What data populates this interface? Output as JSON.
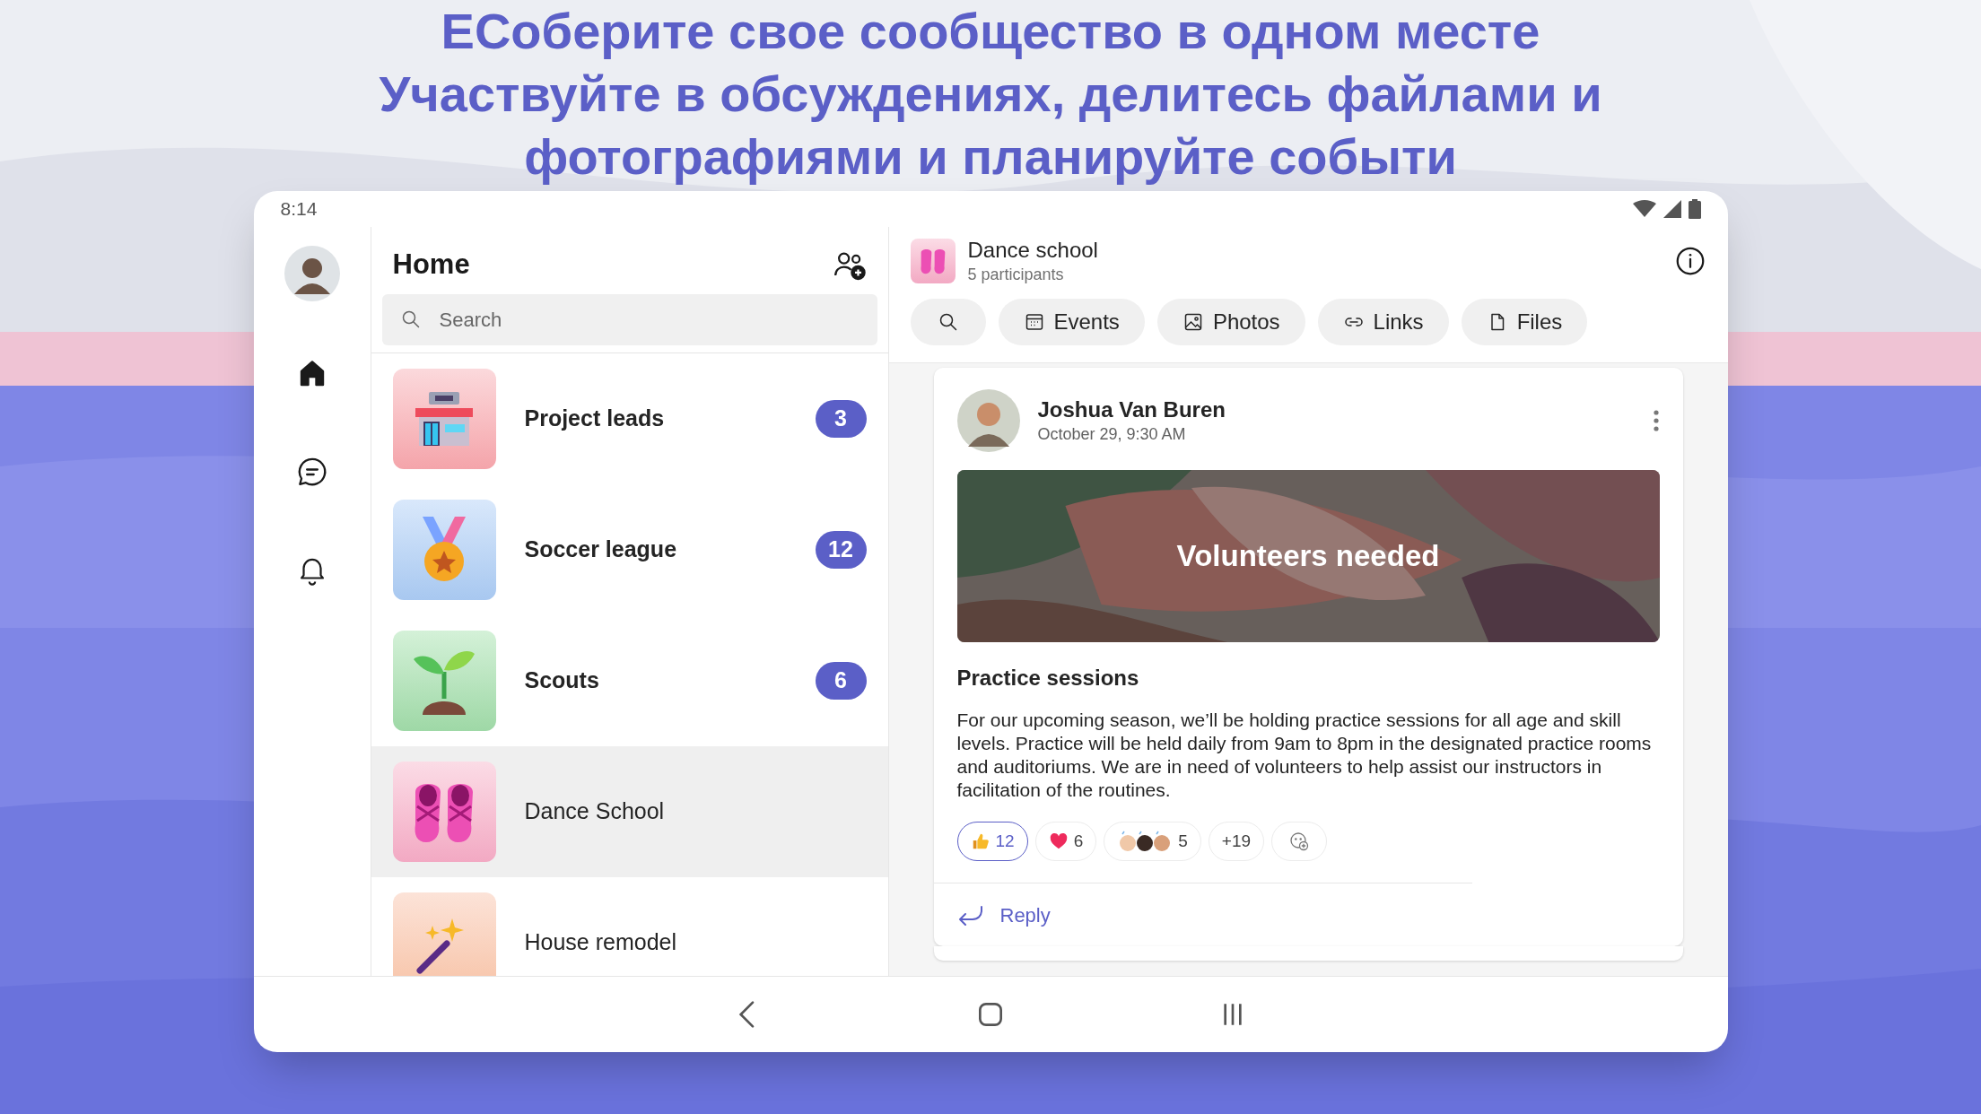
{
  "headline": [
    "ЕСоберите свое сообщество в одном месте",
    "Участвуйте в обсуждениях, делитесь файлами и",
    "фотографиями и планируйте событи"
  ],
  "status_bar": {
    "time": "8:14"
  },
  "nav_rail": [
    {
      "kind": "avatar",
      "selected": false
    },
    {
      "kind": "home",
      "selected": true
    },
    {
      "kind": "chat",
      "selected": false
    },
    {
      "kind": "bell",
      "selected": false
    }
  ],
  "home": {
    "title": "Home",
    "search": {
      "placeholder": "Search"
    },
    "communities": [
      {
        "name": "Project leads",
        "badge": "3",
        "selected": false,
        "kind": "store"
      },
      {
        "name": "Soccer league",
        "badge": "12",
        "selected": false,
        "kind": "medal"
      },
      {
        "name": "Scouts",
        "badge": "6",
        "selected": false,
        "kind": "sprout"
      },
      {
        "name": "Dance School",
        "selected": true,
        "kind": "shoes"
      },
      {
        "name": "House remodel",
        "selected": false,
        "kind": "wand"
      }
    ]
  },
  "conversation": {
    "title": "Dance school",
    "subtitle": "5 participants",
    "chips": [
      {
        "kind": "search"
      },
      {
        "kind": "events",
        "label": "Events"
      },
      {
        "kind": "photos",
        "label": "Photos"
      },
      {
        "kind": "links",
        "label": "Links"
      },
      {
        "kind": "files",
        "label": "Files"
      }
    ],
    "post": {
      "author": "Joshua Van Buren",
      "time": "October 29, 9:30 AM",
      "banner": "Volunteers needed",
      "title": "Practice sessions",
      "body": "For our upcoming season, we’ll be holding practice sessions for all age and skill levels. Practice will be held daily from 9am to 8pm in the designated practice rooms and auditoriums. We are in need of volunteers to help assist our instructors in facilitation of the routines.",
      "reactions": [
        {
          "kind": "thumbs",
          "count": "12",
          "selected": true
        },
        {
          "kind": "heart",
          "count": "6",
          "selected": false
        },
        {
          "kind": "clap",
          "count": "5",
          "selected": false
        },
        {
          "kind": "more",
          "count": "+19",
          "selected": false
        },
        {
          "kind": "add",
          "selected": false
        }
      ],
      "reply": "Reply"
    }
  }
}
